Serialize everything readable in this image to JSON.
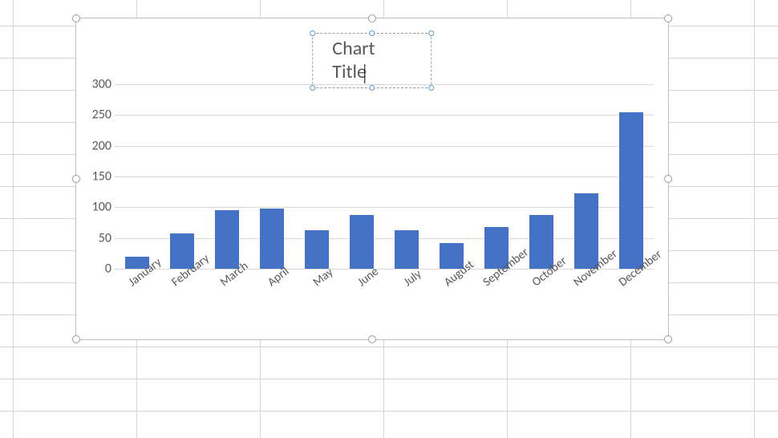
{
  "chart_data": {
    "type": "bar",
    "title": "Chart Title",
    "categories": [
      "January",
      "February",
      "March",
      "April",
      "May",
      "June",
      "July",
      "August",
      "September",
      "October",
      "November",
      "December"
    ],
    "values": [
      20,
      58,
      95,
      98,
      62,
      88,
      62,
      42,
      68,
      88,
      122,
      255
    ],
    "ylim": [
      0,
      300
    ],
    "yticks": [
      0,
      50,
      100,
      150,
      200,
      250,
      300
    ],
    "xlabel": "",
    "ylabel": "",
    "series_color": "#4472c4"
  }
}
